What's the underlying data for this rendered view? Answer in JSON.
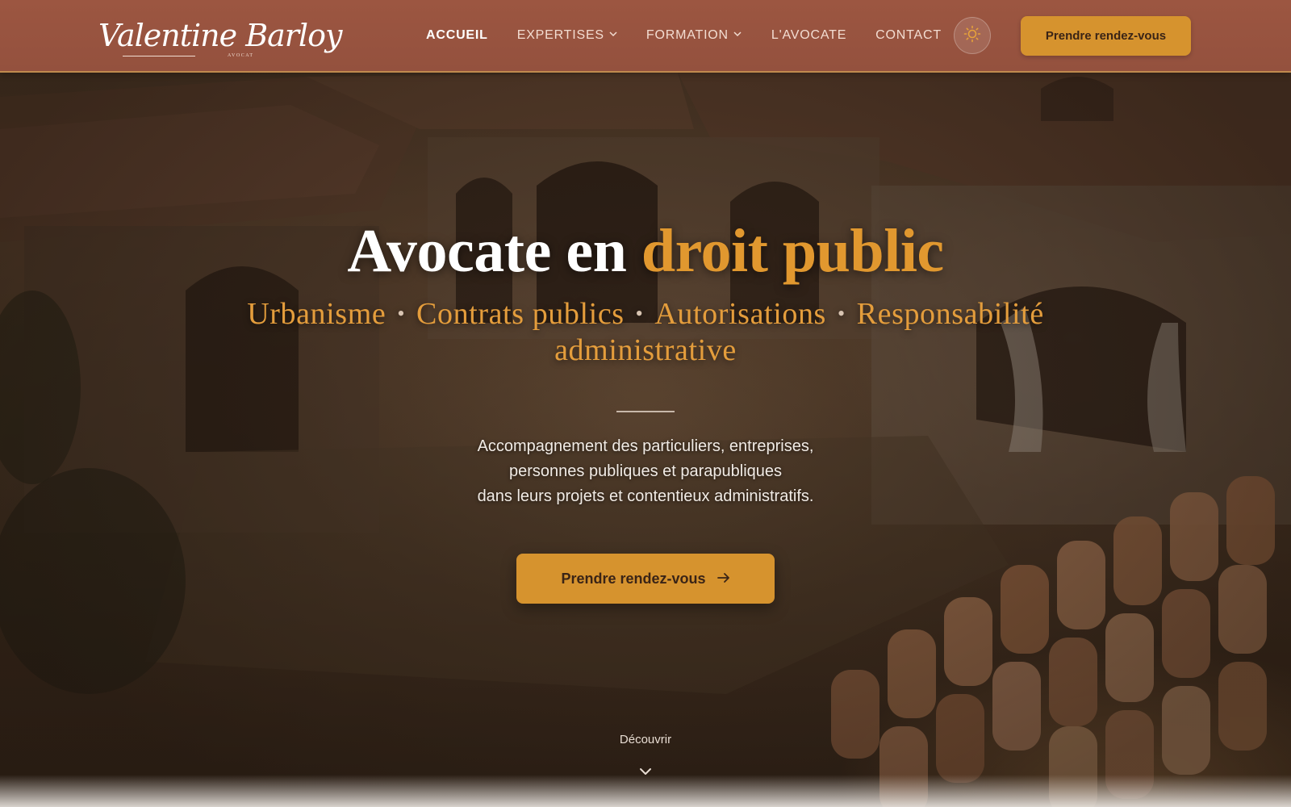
{
  "brand": {
    "logo_text": "Valentine Barloy",
    "logo_subtext": "AVOCAT"
  },
  "nav": {
    "items": [
      {
        "label": "ACCUEIL",
        "active": true,
        "has_dropdown": false
      },
      {
        "label": "EXPERTISES",
        "active": false,
        "has_dropdown": true
      },
      {
        "label": "FORMATION",
        "active": false,
        "has_dropdown": true
      },
      {
        "label": "L'AVOCATE",
        "active": false,
        "has_dropdown": false
      },
      {
        "label": "CONTACT",
        "active": false,
        "has_dropdown": false
      }
    ],
    "theme_toggle_icon": "sun-icon",
    "cta_label": "Prendre rendez-vous"
  },
  "hero": {
    "title_main": "Avocate en ",
    "title_accent": "droit public",
    "subtitle_items": [
      "Urbanisme",
      "Contrats publics",
      "Autorisations",
      "Responsabilité administrative"
    ],
    "description_lines": [
      "Accompagnement des particuliers, entreprises,",
      "personnes publiques et parapubliques",
      "dans leurs projets et contentieux administratifs."
    ],
    "cta_label": "Prendre rendez-vous",
    "cta_icon": "arrow-right-icon",
    "discover_label": "Découvrir",
    "discover_icon": "chevron-down-icon"
  },
  "colors": {
    "header_bg": "#9c5641",
    "accent": "#d6932e",
    "title_accent": "#e1982f",
    "cta_text": "#3a2416"
  }
}
